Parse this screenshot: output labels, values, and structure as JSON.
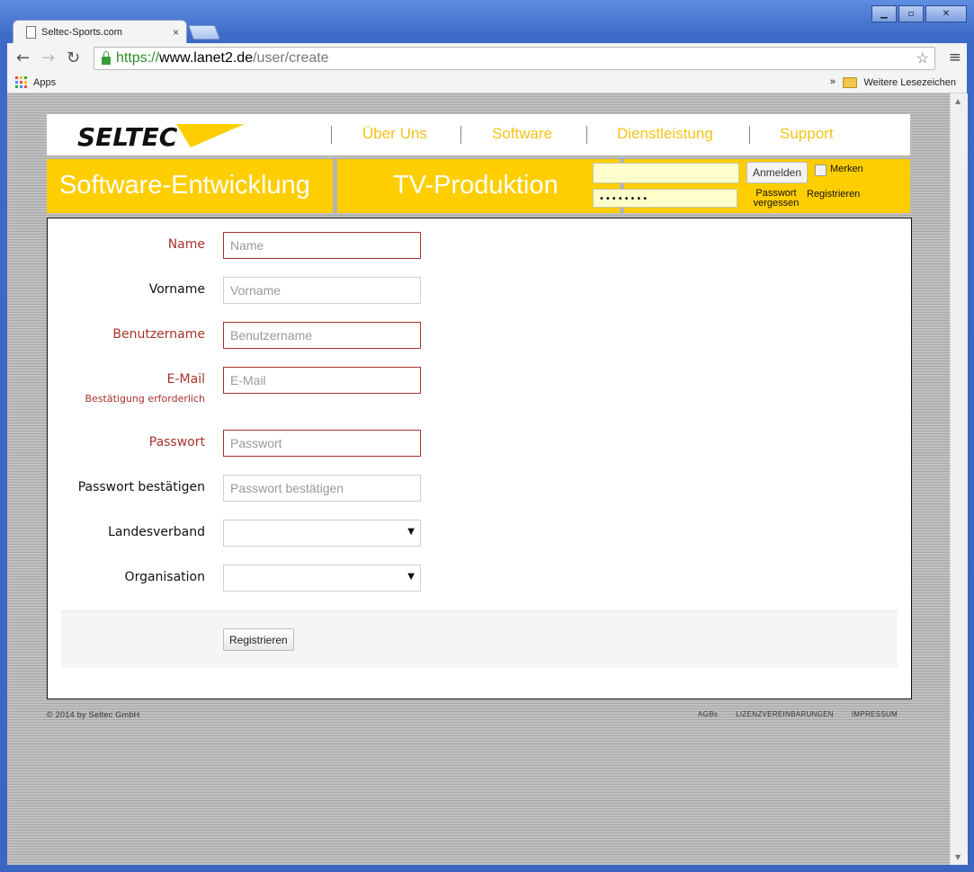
{
  "browser": {
    "tab_title": "Seltec-Sports.com",
    "tab_close": "×",
    "url_scheme": "https://",
    "url_host": "www.lanet2.de",
    "url_path": "/user/create",
    "bookmarks": {
      "apps_label": "Apps",
      "more": "»",
      "folder_label": "Weitere Lesezeichen"
    },
    "window_buttons": {
      "minimize": "▁",
      "maximize": "▫",
      "close": "✕"
    }
  },
  "site": {
    "logo_text": "SELTEC",
    "nav": [
      "Über Uns",
      "Software",
      "Dienstleistung",
      "Support"
    ],
    "band": {
      "left": "Software-Entwicklung",
      "middle": "TV-Produktion"
    },
    "login": {
      "password_mask": "••••••••",
      "submit": "Anmelden",
      "remember": "Merken",
      "forgot": "Passwort vergessen",
      "register": "Registrieren"
    },
    "accent_color": "#ffce00"
  },
  "form": {
    "fields": [
      {
        "label": "Name",
        "placeholder": "Name",
        "required": true
      },
      {
        "label": "Vorname",
        "placeholder": "Vorname",
        "required": false
      },
      {
        "label": "Benutzername",
        "placeholder": "Benutzername",
        "required": true
      },
      {
        "label": "E-Mail",
        "sublabel": "Bestätigung erforderlich",
        "placeholder": "E-Mail",
        "required": true
      },
      {
        "label": "Passwort",
        "placeholder": "Passwort",
        "required": true
      },
      {
        "label": "Passwort bestätigen",
        "placeholder": "Passwort bestätigen",
        "required": false
      }
    ],
    "selects": [
      {
        "label": "Landesverband",
        "value": ""
      },
      {
        "label": "Organisation",
        "value": ""
      }
    ],
    "submit": "Registrieren",
    "required_color": "#a8322d"
  },
  "footer": {
    "copyright": "© 2014 by Seltec GmbH",
    "links": [
      "AGBs",
      "LIZENZVEREINBARUNGEN",
      "IMPRESSUM"
    ]
  }
}
